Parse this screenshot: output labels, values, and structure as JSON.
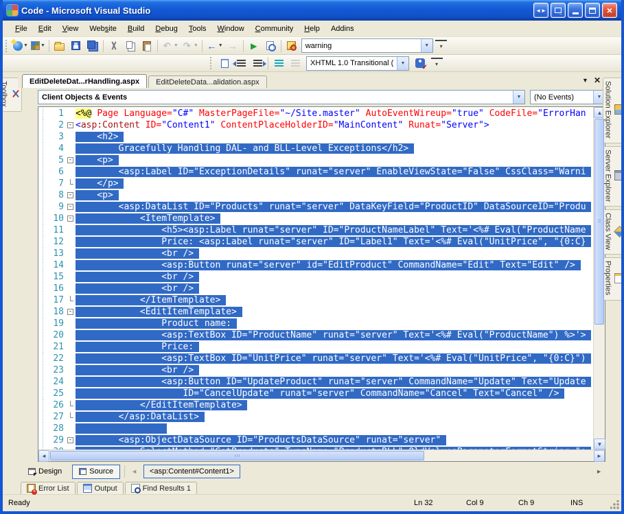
{
  "window": {
    "title": "Code - Microsoft Visual Studio"
  },
  "menu": {
    "items": [
      {
        "label": "File",
        "u": 0
      },
      {
        "label": "Edit",
        "u": 0
      },
      {
        "label": "View",
        "u": 0
      },
      {
        "label": "Website",
        "u": 3
      },
      {
        "label": "Build",
        "u": 0
      },
      {
        "label": "Debug",
        "u": 0
      },
      {
        "label": "Tools",
        "u": 0
      },
      {
        "label": "Window",
        "u": 0
      },
      {
        "label": "Community",
        "u": 0
      },
      {
        "label": "Help",
        "u": 0
      },
      {
        "label": "Addins",
        "u": -1
      }
    ]
  },
  "toolbar1": {
    "find_value": "warning",
    "items": [
      {
        "name": "new-website-button",
        "icon": "globe",
        "drop": true
      },
      {
        "name": "add-new-item-button",
        "icon": "additem",
        "drop": true
      },
      {
        "sep": true
      },
      {
        "name": "open-file-button",
        "icon": "folder"
      },
      {
        "name": "save-button",
        "icon": "floppy"
      },
      {
        "name": "save-all-button",
        "icon": "floppyall"
      },
      {
        "sep": true
      },
      {
        "name": "cut-button",
        "icon": "cut"
      },
      {
        "name": "copy-button",
        "icon": "copy"
      },
      {
        "name": "paste-button",
        "icon": "paste"
      },
      {
        "sep": true
      },
      {
        "name": "undo-button",
        "icon": "undo",
        "glyph": "↶",
        "drop": true,
        "disabled": true
      },
      {
        "name": "redo-button",
        "icon": "redo",
        "glyph": "↷",
        "drop": true,
        "disabled": true
      },
      {
        "sep": true
      },
      {
        "name": "navigate-backward-button",
        "icon": "navback",
        "glyph": "←",
        "drop": true
      },
      {
        "name": "navigate-forward-button",
        "icon": "navfwd",
        "glyph": "→",
        "disabled": true
      },
      {
        "sep": true
      },
      {
        "name": "start-debugging-button",
        "icon": "play",
        "glyph": "▶"
      },
      {
        "name": "preview-in-browser-button",
        "icon": "preview"
      },
      {
        "sep": true
      },
      {
        "name": "find-in-files-button",
        "icon": "findfiles"
      },
      {
        "combo": "warning",
        "name": "find-combo"
      },
      {
        "name": "toolbar-options-button",
        "icon": "chevdown",
        "glyph": "▾"
      }
    ]
  },
  "toolbar2": {
    "schema_value": "XHTML 1.0 Transitional ( ",
    "items": [
      {
        "name": "format-document-button",
        "icon": "pageblue"
      },
      {
        "name": "decrease-indent-button",
        "icon": "outdent"
      },
      {
        "name": "increase-indent-button",
        "icon": "indent"
      },
      {
        "sep": true
      },
      {
        "name": "format-selection-button",
        "icon": "fmtsel"
      },
      {
        "name": "format-whole-document-button",
        "icon": "fmtdoc",
        "disabled": true
      },
      {
        "combo": "XHTML 1.0 Transitional ( ",
        "name": "target-schema-combo"
      },
      {
        "name": "check-accessibility-button",
        "icon": "access"
      },
      {
        "name": "toolbar-options-button",
        "icon": "chevdown",
        "glyph": "▾"
      }
    ]
  },
  "tabs": {
    "active": "EditDeleteDat...rHandling.aspx",
    "inactive": "EditDeleteData...alidation.aspx",
    "dropdown_glyph": "▼",
    "close_glyph": "✕"
  },
  "navbar": {
    "left": "Client Objects & Events",
    "right": "(No Events)"
  },
  "left_tabs": [
    {
      "label": "Toolbox"
    }
  ],
  "right_tabs": [
    {
      "label": "Solution Explorer"
    },
    {
      "label": "Server Explorer"
    },
    {
      "label": "Class View"
    },
    {
      "label": "Properties"
    }
  ],
  "editor": {
    "selection_color": "#316AC5",
    "lines": [
      {
        "n": 1,
        "f": "",
        "tokens": [
          {
            "c": "dir",
            "t": "<%@"
          },
          {
            "c": "pl",
            "t": " "
          },
          {
            "c": "attr",
            "t": "Page Language="
          },
          {
            "c": "val",
            "t": "\"C#\""
          },
          {
            "c": "pl",
            "t": " "
          },
          {
            "c": "attr",
            "t": "MasterPageFile="
          },
          {
            "c": "val",
            "t": "\"~/Site.master\""
          },
          {
            "c": "pl",
            "t": " "
          },
          {
            "c": "attr",
            "t": "AutoEventWireup="
          },
          {
            "c": "val",
            "t": "\"true\""
          },
          {
            "c": "pl",
            "t": " "
          },
          {
            "c": "attr",
            "t": "CodeFile="
          },
          {
            "c": "val",
            "t": "\"ErrorHan"
          }
        ]
      },
      {
        "n": 2,
        "f": "m",
        "tokens": [
          {
            "c": "delim",
            "t": "<"
          },
          {
            "c": "tag",
            "t": "asp:Content"
          },
          {
            "c": "pl",
            "t": " "
          },
          {
            "c": "attr",
            "t": "ID="
          },
          {
            "c": "val",
            "t": "\"Content1\""
          },
          {
            "c": "pl",
            "t": " "
          },
          {
            "c": "attr",
            "t": "ContentPlaceHolderID="
          },
          {
            "c": "val",
            "t": "\"MainContent\""
          },
          {
            "c": "pl",
            "t": " "
          },
          {
            "c": "attr",
            "t": "Runat="
          },
          {
            "c": "val",
            "t": "\"Server\""
          },
          {
            "c": "delim",
            "t": ">"
          }
        ]
      },
      {
        "n": 3,
        "f": "",
        "sel": "    <h2>"
      },
      {
        "n": 4,
        "f": "",
        "sel": "        Gracefully Handling DAL- and BLL-Level Exceptions</h2>"
      },
      {
        "n": 5,
        "f": "m",
        "sel": "    <p>"
      },
      {
        "n": 6,
        "f": "",
        "sel": "        <asp:Label ID=\"ExceptionDetails\" runat=\"server\" EnableViewState=\"False\" CssClass=\"Warni"
      },
      {
        "n": 7,
        "f": "e",
        "sel": "    </p>"
      },
      {
        "n": 8,
        "f": "m",
        "sel": "    <p>"
      },
      {
        "n": 9,
        "f": "m",
        "sel": "        <asp:DataList ID=\"Products\" runat=\"server\" DataKeyField=\"ProductID\" DataSourceID=\"Produ"
      },
      {
        "n": 10,
        "f": "m",
        "sel": "            <ItemTemplate>"
      },
      {
        "n": 11,
        "f": "",
        "sel": "                <h5><asp:Label runat=\"server\" ID=\"ProductNameLabel\" Text='<%# Eval(\"ProductName"
      },
      {
        "n": 12,
        "f": "",
        "sel": "                Price: <asp:Label runat=\"server\" ID=\"Label1\" Text='<%# Eval(\"UnitPrice\", \"{0:C}"
      },
      {
        "n": 13,
        "f": "",
        "sel": "                <br />"
      },
      {
        "n": 14,
        "f": "",
        "sel": "                <asp:Button runat=\"server\" id=\"EditProduct\" CommandName=\"Edit\" Text=\"Edit\" />"
      },
      {
        "n": 15,
        "f": "",
        "sel": "                <br />"
      },
      {
        "n": 16,
        "f": "",
        "sel": "                <br />"
      },
      {
        "n": 17,
        "f": "e",
        "sel": "            </ItemTemplate>"
      },
      {
        "n": 18,
        "f": "m",
        "sel": "            <EditItemTemplate>"
      },
      {
        "n": 19,
        "f": "",
        "sel": "                Product name:"
      },
      {
        "n": 20,
        "f": "",
        "sel": "                <asp:TextBox ID=\"ProductName\" runat=\"server\" Text='<%# Eval(\"ProductName\") %>'>"
      },
      {
        "n": 21,
        "f": "",
        "sel": "                Price:"
      },
      {
        "n": 22,
        "f": "",
        "sel": "                <asp:TextBox ID=\"UnitPrice\" runat=\"server\" Text='<%# Eval(\"UnitPrice\", \"{0:C}\")"
      },
      {
        "n": 23,
        "f": "",
        "sel": "                <br />"
      },
      {
        "n": 24,
        "f": "",
        "sel": "                <asp:Button ID=\"UpdateProduct\" runat=\"server\" CommandName=\"Update\" Text=\"Update"
      },
      {
        "n": 25,
        "f": "",
        "sel": "                    ID=\"CancelUpdate\" runat=\"server\" CommandName=\"Cancel\" Text=\"Cancel\" />"
      },
      {
        "n": 26,
        "f": "e",
        "sel": "            </EditItemTemplate>"
      },
      {
        "n": 27,
        "f": "e",
        "sel": "        </asp:DataList>"
      },
      {
        "n": 28,
        "f": "",
        "sel": "                "
      },
      {
        "n": 29,
        "f": "m",
        "sel": "        <asp:ObjectDataSource ID=\"ProductsDataSource\" runat=\"server\""
      },
      {
        "n": 30,
        "f": "",
        "sel": "            SelectMethod=\"GetProducts\" TypeName=\"ProductsBLL\" OldValuesParameterFormatString=\"o"
      }
    ]
  },
  "viewbar": {
    "design": "Design",
    "source": "Source",
    "tag": "<asp:Content#Content1>"
  },
  "bottom_tabs": [
    {
      "label": "Error List"
    },
    {
      "label": "Output"
    },
    {
      "label": "Find Results 1"
    }
  ],
  "statusbar": {
    "ready": "Ready",
    "ln": "Ln 32",
    "col": "Col 9",
    "ch": "Ch 9",
    "ins": "INS"
  },
  "icons": [
    "vs-logo-icon",
    "window-arrows-icon",
    "window-popout-icon",
    "minimize-icon",
    "maximize-icon",
    "close-icon",
    "new-website-icon",
    "add-new-item-icon",
    "open-folder-icon",
    "save-icon",
    "save-all-icon",
    "cut-icon",
    "copy-icon",
    "paste-icon",
    "undo-icon",
    "redo-icon",
    "navigate-backward-icon",
    "navigate-forward-icon",
    "start-debug-icon",
    "preview-icon",
    "find-in-files-icon",
    "format-document-icon",
    "decrease-indent-icon",
    "increase-indent-icon",
    "format-selection-icon",
    "check-accessibility-icon",
    "toolbox-icon",
    "solution-explorer-icon",
    "server-explorer-icon",
    "class-view-icon",
    "properties-icon",
    "error-list-icon",
    "output-icon",
    "find-results-icon",
    "fold-collapse-icon",
    "scroll-arrow-icons"
  ]
}
